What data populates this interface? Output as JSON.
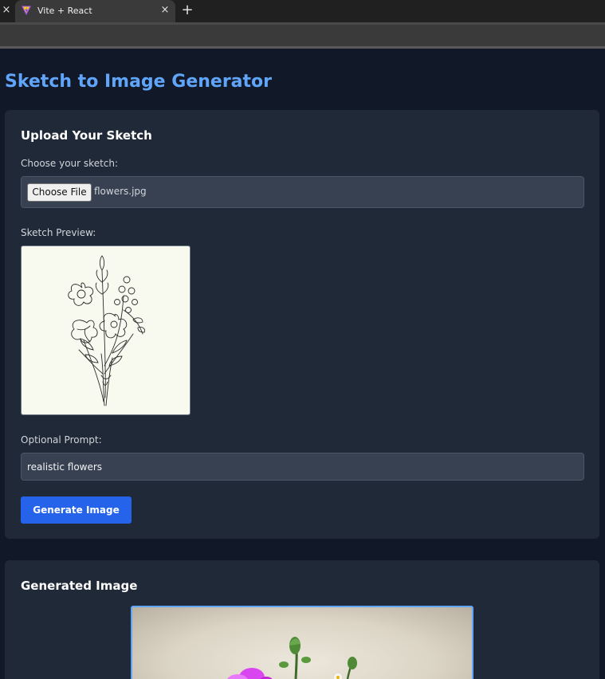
{
  "browser": {
    "tab_title": "Vite + React",
    "tab_close_glyph": "×",
    "prev_tab_close_glyph": "×",
    "new_tab_glyph": "+"
  },
  "page": {
    "title": "Sketch to Image Generator"
  },
  "upload": {
    "heading": "Upload Your Sketch",
    "choose_label": "Choose your sketch:",
    "choose_button": "Choose File",
    "file_name": "flowers.jpg",
    "preview_label": "Sketch Preview:",
    "prompt_label": "Optional Prompt:",
    "prompt_value": "realistic flowers",
    "generate_button": "Generate Image"
  },
  "generated": {
    "heading": "Generated Image"
  },
  "colors": {
    "accent": "#60a5fa",
    "button": "#2563eb",
    "card": "#1f2937",
    "background": "#111827"
  }
}
